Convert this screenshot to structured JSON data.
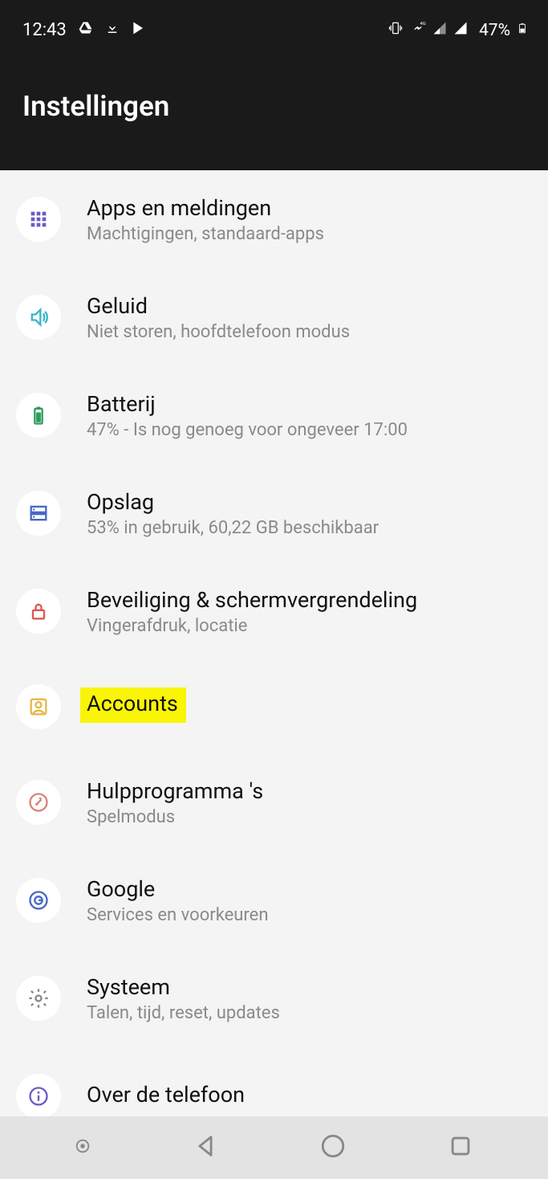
{
  "status": {
    "time": "12:43",
    "battery_pct": "47%"
  },
  "page_title": "Instellingen",
  "items": [
    {
      "icon": "apps",
      "title": "Apps en meldingen",
      "sub": "Machtigingen, standaard-apps"
    },
    {
      "icon": "sound",
      "title": "Geluid",
      "sub": "Niet storen, hoofdtelefoon modus"
    },
    {
      "icon": "battery",
      "title": "Batterij",
      "sub": "47% - Is nog genoeg voor ongeveer 17:00"
    },
    {
      "icon": "storage",
      "title": "Opslag",
      "sub": "53% in gebruik, 60,22 GB beschikbaar"
    },
    {
      "icon": "security",
      "title": "Beveiliging & schermvergrendeling",
      "sub": "Vingerafdruk, locatie"
    },
    {
      "icon": "accounts",
      "title": "Accounts",
      "sub": ""
    },
    {
      "icon": "utilities",
      "title": "Hulpprogramma 's",
      "sub": "Spelmodus"
    },
    {
      "icon": "google",
      "title": "Google",
      "sub": "Services en voorkeuren"
    },
    {
      "icon": "system",
      "title": "Systeem",
      "sub": "Talen, tijd, reset, updates"
    },
    {
      "icon": "about",
      "title": "Over de telefoon",
      "sub": ""
    }
  ]
}
